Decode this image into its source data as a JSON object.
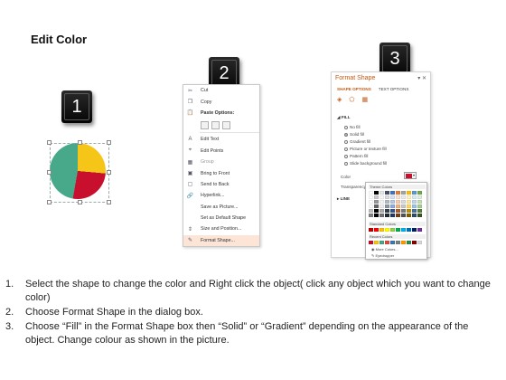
{
  "page": {
    "title": "Edit Color"
  },
  "badges": [
    "1",
    "2",
    "3"
  ],
  "pie": {
    "colors": {
      "yellow": "#f5c518",
      "red": "#c8102e",
      "green": "#47a98a"
    }
  },
  "context_menu": {
    "items_top": [
      {
        "label": "Cut",
        "icon": "scissors-icon"
      },
      {
        "label": "Copy",
        "icon": "copy-icon"
      },
      {
        "label": "Paste Options:",
        "icon": "paste-icon"
      }
    ],
    "items_bottom": [
      {
        "label": "Edit Text",
        "icon": "edit-text-icon"
      },
      {
        "label": "Edit Points",
        "icon": "edit-points-icon"
      },
      {
        "label": "Group",
        "icon": "group-icon"
      },
      {
        "label": "Bring to Front",
        "icon": "bring-front-icon"
      },
      {
        "label": "Send to Back",
        "icon": "send-back-icon"
      },
      {
        "label": "Hyperlink...",
        "icon": "hyperlink-icon"
      },
      {
        "label": "Save as Picture...",
        "icon": ""
      },
      {
        "label": "Set as Default Shape",
        "icon": ""
      },
      {
        "label": "Size and Position...",
        "icon": "size-icon"
      },
      {
        "label": "Format Shape...",
        "icon": "format-shape-icon"
      }
    ]
  },
  "format_pane": {
    "title": "Format Shape",
    "tabs": [
      "SHAPE OPTIONS",
      "TEXT OPTIONS"
    ],
    "fill_section": "FILL",
    "fill_options": [
      "No fill",
      "Solid fill",
      "Gradient fill",
      "Picture or texture fill",
      "Pattern fill",
      "Slide background fill"
    ],
    "color_label": "Color",
    "transparency_label": "Transparency",
    "line_section": "LINE",
    "palette": {
      "theme_label": "Theme Colors",
      "standard_label": "Standard Colors",
      "recent_label": "Recent Colors",
      "more_colors": "More Colors...",
      "eyedropper": "Eyedropper"
    }
  },
  "steps": [
    {
      "num": "1.",
      "text": "Select the shape to change the color and Right click the object( click any object which you want to change color)"
    },
    {
      "num": "2.",
      "text": "Choose Format Shape in the dialog box."
    },
    {
      "num": "3.",
      "text": "Choose “Fill” in the Format Shape box then “Solid” or “Gradient” depending on the appearance of the object. Change colour as shown in the picture."
    }
  ]
}
